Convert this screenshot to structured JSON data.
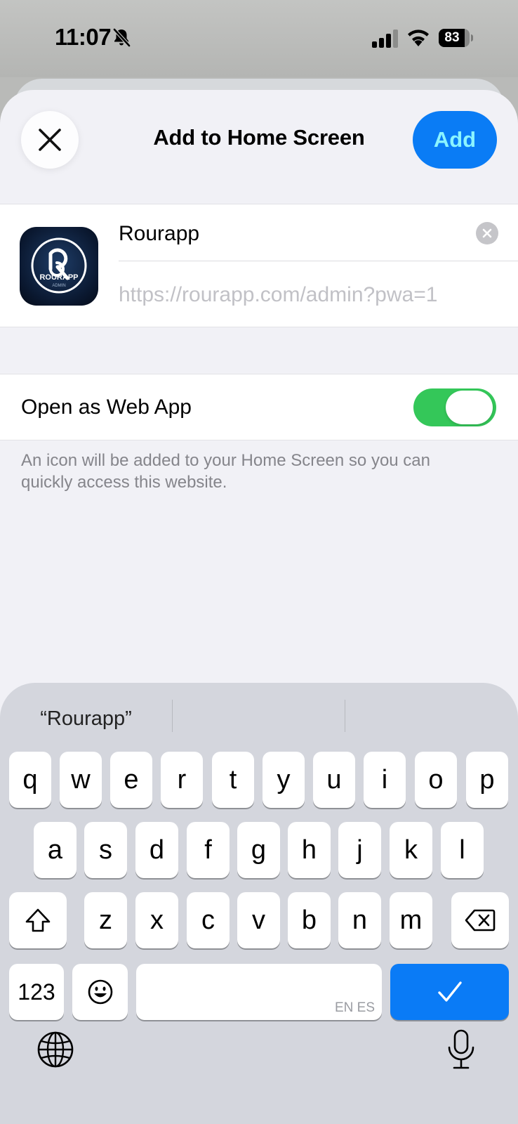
{
  "status_bar": {
    "time": "11:07",
    "battery_level": "83",
    "battery_fraction": 0.83,
    "signal_bars_active": 3,
    "icons": [
      "bell-slash-icon",
      "cellular-signal-icon",
      "wifi-icon",
      "battery-icon"
    ]
  },
  "sheet": {
    "title": "Add to Home Screen",
    "close_icon": "close-icon",
    "add_label": "Add",
    "accent_color": "#0a7cf5"
  },
  "app": {
    "icon_label": "ROURAPP",
    "icon_sublabel": "ADMIN",
    "name_value": "Rourapp",
    "url": "https://rourapp.com/admin?pwa=1"
  },
  "web_app_toggle": {
    "label": "Open as Web App",
    "on": true,
    "color": "#34c759"
  },
  "footnote": "An icon will be added to your Home Screen so you can quickly access this website.",
  "keyboard": {
    "suggestions": [
      "“Rourapp”",
      "",
      ""
    ],
    "row1": [
      "q",
      "w",
      "e",
      "r",
      "t",
      "y",
      "u",
      "i",
      "o",
      "p"
    ],
    "row2": [
      "a",
      "s",
      "d",
      "f",
      "g",
      "h",
      "j",
      "k",
      "l"
    ],
    "row3": [
      "z",
      "x",
      "c",
      "v",
      "b",
      "n",
      "m"
    ],
    "numbers_label": "123",
    "space_languages": "EN ES",
    "icons": [
      "shift-icon",
      "backspace-icon",
      "emoji-icon",
      "checkmark-icon",
      "globe-icon",
      "microphone-icon"
    ]
  }
}
